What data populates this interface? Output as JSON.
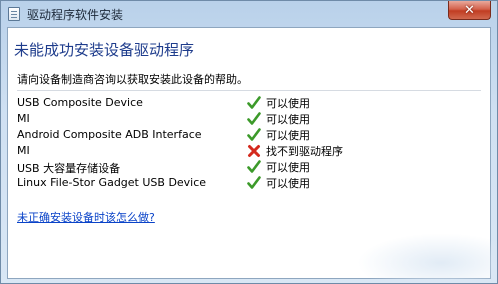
{
  "window": {
    "title": "驱动程序软件安装",
    "close_label": "✕"
  },
  "main": {
    "heading": "未能成功安装设备驱动程序",
    "description": "请向设备制造商咨询以获取安装此设备的帮助。",
    "devices": [
      {
        "name": "USB Composite Device",
        "status": "可以使用",
        "status_icon": "check-icon",
        "status_color": "#3c9a2a"
      },
      {
        "name": "MI",
        "status": "可以使用",
        "status_icon": "check-icon",
        "status_color": "#3c9a2a"
      },
      {
        "name": "Android Composite ADB Interface",
        "status": "可以使用",
        "status_icon": "check-icon",
        "status_color": "#3c9a2a"
      },
      {
        "name": "MI",
        "status": "找不到驱动程序",
        "status_icon": "error-x-icon",
        "status_color": "#d42a1e"
      },
      {
        "name": "USB 大容量存储设备",
        "status": "可以使用",
        "status_icon": "check-icon",
        "status_color": "#3c9a2a"
      },
      {
        "name": "Linux File-Stor Gadget USB Device",
        "status": "可以使用",
        "status_icon": "check-icon",
        "status_color": "#3c9a2a"
      }
    ],
    "help_link": "未正确安装设备时该怎么做?"
  },
  "colors": {
    "heading": "#1e3c8c",
    "link": "#0a43c8",
    "close_button": "#c13d22"
  }
}
